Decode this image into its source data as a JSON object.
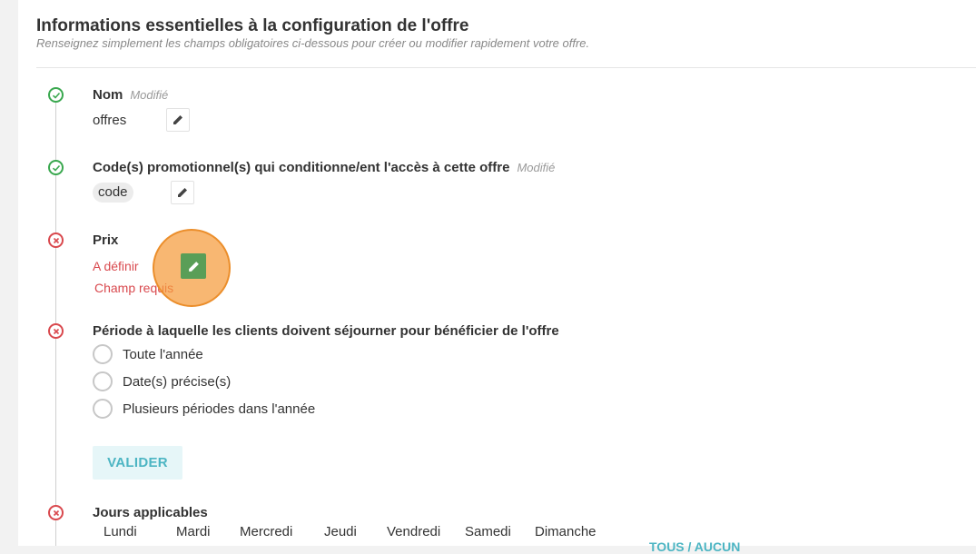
{
  "header": {
    "title": "Informations essentielles à la configuration de l'offre",
    "subtitle": "Renseignez simplement les champs obligatoires ci-dessous pour créer ou modifier rapidement votre offre."
  },
  "steps": {
    "nom": {
      "label": "Nom",
      "status_text": "Modifié",
      "value": "offres"
    },
    "code": {
      "label": "Code(s) promotionnel(s) qui conditionne/ent l'accès à cette offre",
      "status_text": "Modifié",
      "value": "code"
    },
    "prix": {
      "label": "Prix",
      "value": "A définir",
      "error": "Champ requis"
    },
    "periode": {
      "label": "Période à laquelle les clients doivent séjourner pour bénéficier de l'offre",
      "options": [
        "Toute l'année",
        "Date(s) précise(s)",
        "Plusieurs périodes dans l'année"
      ],
      "submit_label": "VALIDER"
    },
    "jours": {
      "label": "Jours applicables",
      "days": [
        "Lundi",
        "Mardi",
        "Mercredi",
        "Jeudi",
        "Vendredi",
        "Samedi",
        "Dimanche"
      ],
      "toggle_all_label": "TOUS / AUCUN"
    }
  },
  "colors": {
    "success": "#3aa84f",
    "error": "#d9494e",
    "accent": "#4cb5c3",
    "highlight": "#f59b3c"
  },
  "icons": {
    "ok": "check-circle-icon",
    "error": "x-circle-icon",
    "edit": "pencil-icon"
  }
}
